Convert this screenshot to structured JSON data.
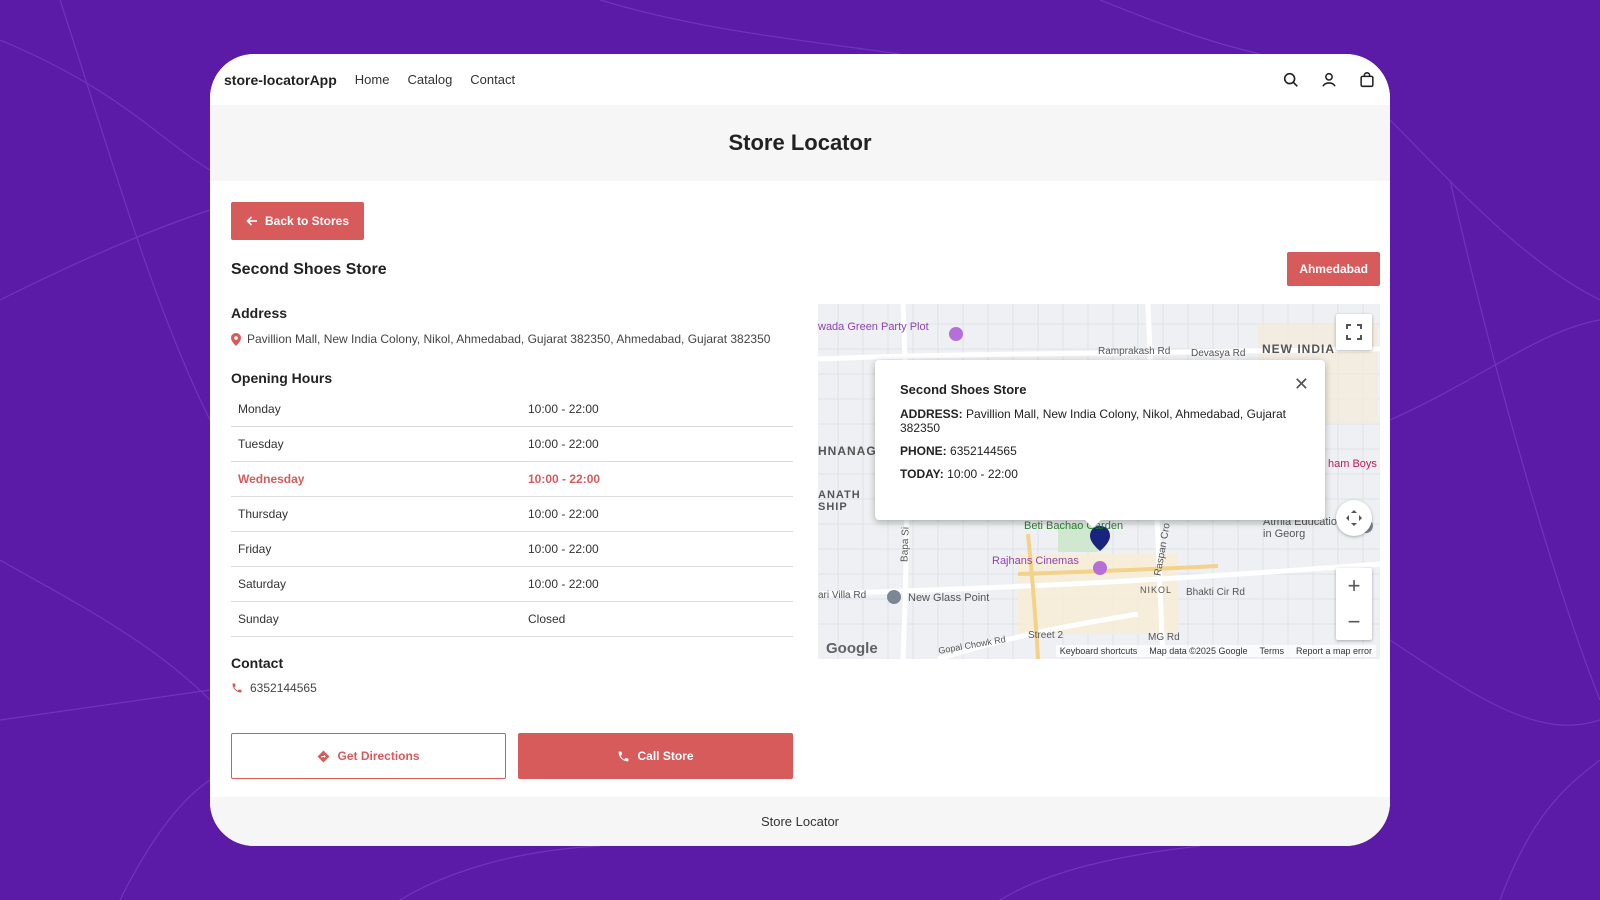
{
  "nav": {
    "brand": "store-locatorApp",
    "links": [
      "Home",
      "Catalog",
      "Contact"
    ],
    "icons": [
      "search-icon",
      "user-icon",
      "bag-icon"
    ]
  },
  "page": {
    "title": "Store Locator"
  },
  "actions": {
    "back_label": "Back to Stores",
    "directions_label": "Get Directions",
    "call_label": "Call Store"
  },
  "store": {
    "name": "Second Shoes Store",
    "city": "Ahmedabad",
    "address_title": "Address",
    "address": "Pavillion Mall, New India Colony, Nikol, Ahmedabad, Gujarat 382350, Ahmedabad, Gujarat 382350",
    "hours_title": "Opening Hours",
    "hours": [
      {
        "day": "Monday",
        "time": "10:00 - 22:00"
      },
      {
        "day": "Tuesday",
        "time": "10:00 - 22:00"
      },
      {
        "day": "Wednesday",
        "time": "10:00 - 22:00"
      },
      {
        "day": "Thursday",
        "time": "10:00 - 22:00"
      },
      {
        "day": "Friday",
        "time": "10:00 - 22:00"
      },
      {
        "day": "Saturday",
        "time": "10:00 - 22:00"
      },
      {
        "day": "Sunday",
        "time": "Closed"
      }
    ],
    "today_index": 2,
    "contact_title": "Contact",
    "phone": "6352144565"
  },
  "map": {
    "labels": {
      "l1": "wada Green Party Plot",
      "l2": "Ramprakash Rd",
      "l3": "Devasya Rd",
      "l4": "NEW INDIA",
      "l5": "HNANAG",
      "l6": "ANATH SHIP",
      "l7": "ham Boys",
      "l8": "Beti Bachao Garden",
      "l9": "Rajhans Cinemas",
      "l10": "New Glass Point",
      "l11": "ari Villa Rd",
      "l12": "Atmia Educatio MBBS in Georg",
      "l13": "NIKOL",
      "l14": "Bhakti Cir Rd",
      "l15": "Street 2",
      "l16": "MG Rd",
      "l17": "Bapa Si",
      "l18": "Raspan Cro",
      "l19": "Gopal Chowk Rd"
    },
    "google": "Google",
    "footer": [
      "Keyboard shortcuts",
      "Map data ©2025 Google",
      "Terms",
      "Report a map error"
    ],
    "info": {
      "title": "Second Shoes Store",
      "address_label": "ADDRESS:",
      "address": "Pavillion Mall, New India Colony, Nikol, Ahmedabad, Gujarat 382350",
      "phone_label": "PHONE:",
      "phone": "6352144565",
      "today_label": "TODAY:",
      "today": "10:00 - 22:00"
    }
  },
  "footer": {
    "text": "Store Locator"
  },
  "colors": {
    "accent": "#d85b5b",
    "background": "#5b1ba6"
  }
}
